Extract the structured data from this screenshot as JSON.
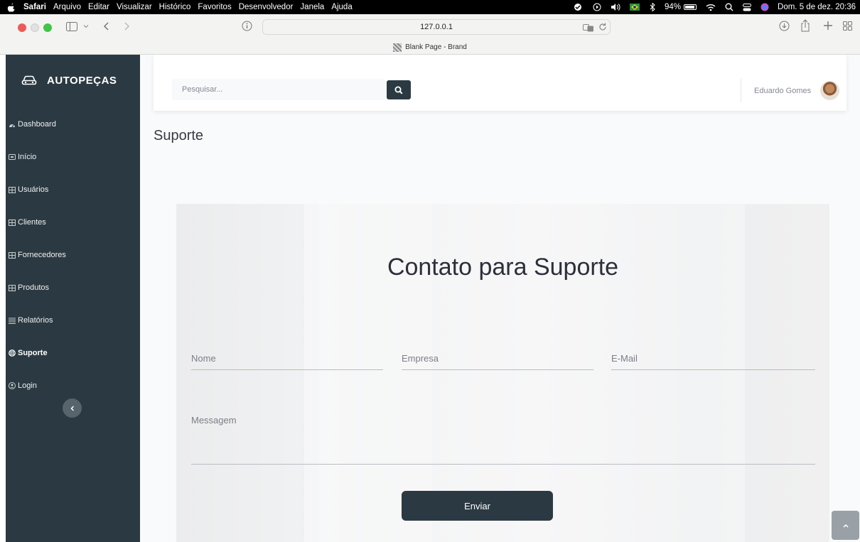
{
  "menubar": {
    "items": [
      "Safari",
      "Arquivo",
      "Editar",
      "Visualizar",
      "Histórico",
      "Favoritos",
      "Desenvolvedor",
      "Janela",
      "Ajuda"
    ],
    "battery": "94%",
    "clock": "Dom. 5 de dez.  20:36"
  },
  "browser": {
    "url": "127.0.0.1",
    "tab_title": "Blank Page - Brand"
  },
  "sidebar": {
    "brand": "AUTOPEÇAS",
    "items": [
      {
        "label": "Dashboard",
        "icon": "tachometer-icon"
      },
      {
        "label": "Início",
        "icon": "window-icon"
      },
      {
        "label": "Usuários",
        "icon": "table-icon"
      },
      {
        "label": "Clientes",
        "icon": "table-icon"
      },
      {
        "label": "Fornecedores",
        "icon": "table-icon"
      },
      {
        "label": "Produtos",
        "icon": "table-icon"
      },
      {
        "label": "Relatórios",
        "icon": "list-icon"
      },
      {
        "label": "Suporte",
        "icon": "lifebuoy-icon",
        "active": true
      },
      {
        "label": "Login",
        "icon": "user-circle-icon"
      }
    ]
  },
  "topbar": {
    "search_placeholder": "Pesquisar...",
    "user_name": "Eduardo Gomes"
  },
  "page": {
    "title": "Suporte"
  },
  "contact": {
    "heading": "Contato para Suporte",
    "name_placeholder": "Nome",
    "company_placeholder": "Empresa",
    "email_placeholder": "E-Mail",
    "message_placeholder": "Messagem",
    "submit_label": "Enviar"
  },
  "colors": {
    "sidebar_bg": "#2b3a42",
    "button_bg": "#2b3a42",
    "page_bg": "#f9fafb"
  }
}
